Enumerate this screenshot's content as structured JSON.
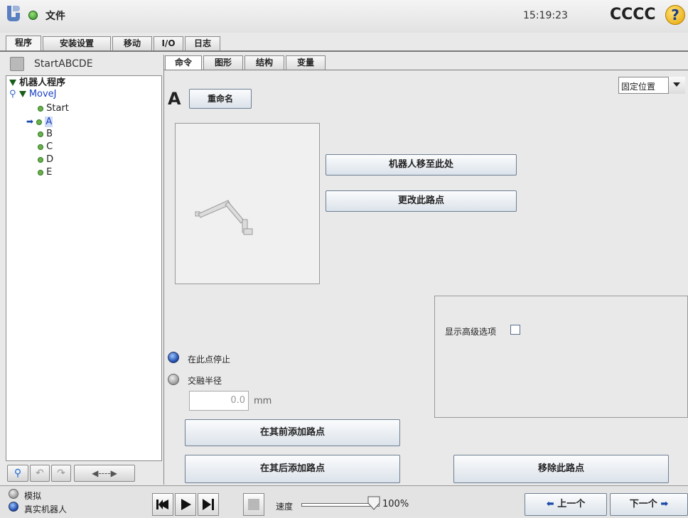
{
  "header": {
    "file_label": "文件",
    "time": "15:19:23",
    "robot_name": "CCCC",
    "help_glyph": "?"
  },
  "main_tabs": [
    {
      "label": "程序",
      "active": true
    },
    {
      "label": "安装设置",
      "active": false
    },
    {
      "label": "移动",
      "active": false
    },
    {
      "label": "I/O",
      "active": false
    },
    {
      "label": "日志",
      "active": false
    }
  ],
  "program": {
    "name": "StartABCDE",
    "tree": {
      "root": "机器人程序",
      "move": "MoveJ",
      "waypoints": [
        "Start",
        "A",
        "B",
        "C",
        "D",
        "E"
      ],
      "selected": "A"
    }
  },
  "sub_tabs": [
    {
      "label": "命令",
      "active": true
    },
    {
      "label": "图形",
      "active": false
    },
    {
      "label": "结构",
      "active": false
    },
    {
      "label": "变量",
      "active": false
    }
  ],
  "waypoint": {
    "name": "A",
    "rename_label": "重命名",
    "position_mode": "固定位置",
    "move_here_label": "机器人移至此处",
    "change_label": "更改此路点",
    "advanced_label": "显示高级选项",
    "stop_label": "在此点停止",
    "blend_label": "交融半径",
    "blend_value": "0.0",
    "blend_unit": "mm",
    "add_before_label": "在其前添加路点",
    "add_after_label": "在其后添加路点",
    "remove_label": "移除此路点"
  },
  "footer": {
    "simulation_label": "模拟",
    "real_robot_label": "真实机器人",
    "speed_label": "速度",
    "speed_value": "100%",
    "speed_fraction": 1.0,
    "prev_label": "上一个",
    "next_label": "下一个"
  },
  "colors": {
    "accent": "#1b47a8",
    "status_ok": "#2a8a20",
    "help": "#e7a400"
  }
}
